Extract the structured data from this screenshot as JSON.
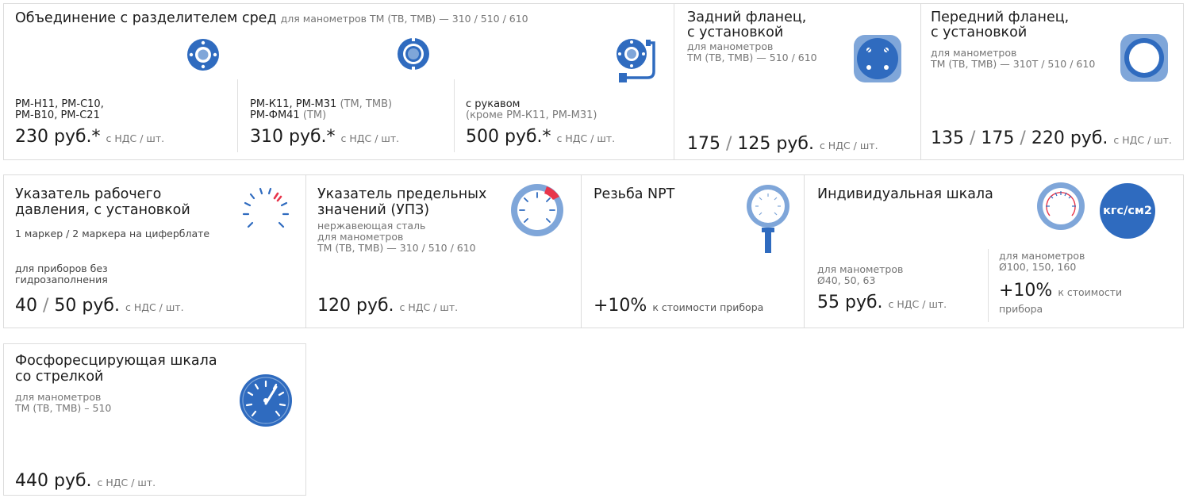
{
  "row1": {
    "union": {
      "title": "Объединение с разделителем сред",
      "subtitle": "для манометров ТМ (ТВ, ТМВ) — 310 / 510 / 610",
      "cols": [
        {
          "line1": "РМ-Н11, РМ-С10,",
          "line2": "РМ-В10, РМ-С21",
          "price": "230 руб.*",
          "unit": "с НДС / шт."
        },
        {
          "line1": "РМ-К11, РМ-М31",
          "line1_note": "(ТМ, ТМВ)",
          "line2": "РМ-ФМ41",
          "line2_note": "(ТМ)",
          "price": "310 руб.*",
          "unit": "с НДС / шт."
        },
        {
          "line1": "с рукавом",
          "line2": "(кроме РМ-К11, РМ-М31)",
          "price": "500 руб.*",
          "unit": "с НДС / шт."
        }
      ]
    },
    "rear_flange": {
      "title1": "Задний фланец,",
      "title2": "с установкой",
      "sub1": "для манометров",
      "sub2": "ТМ (ТВ, ТМВ) — 510 / 610",
      "price_a": "175",
      "slash": "/",
      "price_b": "125 руб.",
      "unit": "с НДС / шт."
    },
    "front_flange": {
      "title1": "Передний фланец,",
      "title2": "с установкой",
      "sub1": "для манометров",
      "sub2": "ТМ (ТВ, ТМВ) — 310Т / 510 / 610",
      "price_a": "135",
      "price_b": "175",
      "price_c": "220 руб.",
      "slash": "/",
      "unit": "с НДС / шт."
    }
  },
  "row2": {
    "working_pointer": {
      "title1": "Указатель рабочего",
      "title2": "давления, с установкой",
      "sub": "1 маркер / 2 маркера на циферблате",
      "note1": "для приборов без",
      "note2": "гидрозаполнения",
      "price_a": "40",
      "slash": "/",
      "price_b": "50 руб.",
      "unit": "с НДС / шт."
    },
    "limit_pointer": {
      "title1": "Указатель предельных",
      "title2": "значений (УПЗ)",
      "sub1": "нержавеющая сталь",
      "sub2": "для манометров",
      "sub3": "ТМ (ТВ, ТМВ) — 310 / 510 / 610",
      "price": "120 руб.",
      "unit": "с НДС / шт."
    },
    "npt": {
      "title": "Резьба NPT",
      "price": "+10%",
      "unit": "к стоимости прибора"
    },
    "custom_scale": {
      "title": "Индивидуальная шкала",
      "badge": "кгс/см2",
      "left": {
        "sub1": "для манометров",
        "sub2": "Ø40, 50, 63",
        "price": "55 руб.",
        "unit": "с НДС / шт."
      },
      "right": {
        "sub1": "для манометров",
        "sub2": "Ø100, 150, 160",
        "price": "+10%",
        "unit1": "к стоимости",
        "unit2": "прибора"
      }
    }
  },
  "row3": {
    "phosphor": {
      "title1": "Фосфоресцирующая шкала",
      "title2": "со стрелкой",
      "sub1": "для манометров",
      "sub2": "ТМ (ТВ, ТМВ) – 510",
      "price": "440 руб.",
      "unit": "с НДС / шт."
    }
  },
  "colors": {
    "blue_dark": "#2f6bbf",
    "blue_light": "#7fa6d9",
    "red": "#e8354b",
    "border": "#dcdcdc"
  }
}
